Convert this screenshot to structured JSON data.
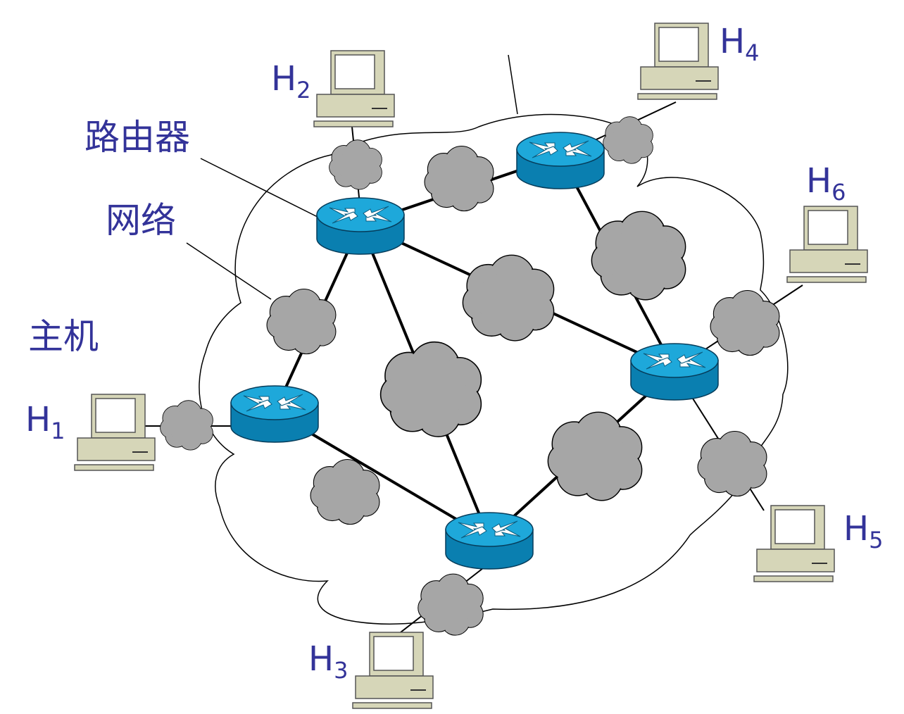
{
  "labels": {
    "router": "路由器",
    "network": "网络",
    "host": "主机"
  },
  "hosts": [
    {
      "letter": "H",
      "index": "1"
    },
    {
      "letter": "H",
      "index": "2"
    },
    {
      "letter": "H",
      "index": "3"
    },
    {
      "letter": "H",
      "index": "4"
    },
    {
      "letter": "H",
      "index": "5"
    },
    {
      "letter": "H",
      "index": "6"
    }
  ],
  "colors": {
    "label_text": "#333399",
    "router_fill": "#0a86b8",
    "router_top": "#1aa6d8",
    "cloud_fill": "#a6a6a6",
    "computer_fill": "#d6d6b8",
    "line": "#000000"
  },
  "icons": {
    "router": "router-icon",
    "network": "cloud-icon",
    "host": "desktop-computer-icon"
  }
}
